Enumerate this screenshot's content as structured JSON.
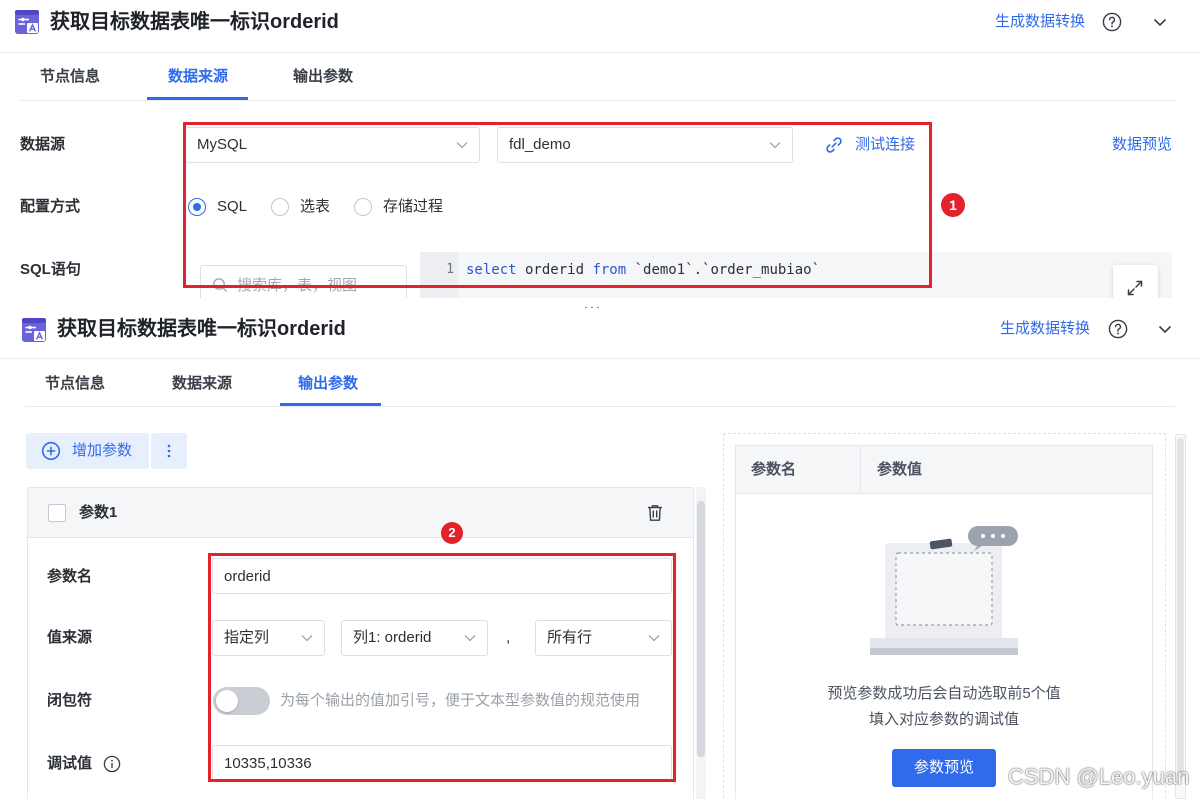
{
  "colors": {
    "accent": "#2f6bea",
    "accent_light": "#e7effd",
    "annotation_red": "#e3222c",
    "toggle_off": "#c9cdd4"
  },
  "icons": {
    "node_type": "node-type-icon",
    "help": "help-icon",
    "collapse": "chevron-down-icon",
    "select_arrow": "chevron-down-icon",
    "test_connection": "link-icon",
    "search": "search-icon",
    "expand_editor": "expand-icon",
    "resize_handle": "drag-handle-icon",
    "add_param": "add-circle-icon",
    "more": "more-vertical-icon",
    "delete": "trash-icon",
    "debug_info": "info-icon"
  },
  "top": {
    "title": "获取目标数据表唯一标识orderid",
    "generate_link": "生成数据转换",
    "tabs": [
      {
        "label": "节点信息",
        "active": false
      },
      {
        "label": "数据来源",
        "active": true
      },
      {
        "label": "输出参数",
        "active": false
      }
    ],
    "datasource": {
      "label": "数据源",
      "db_type": "MySQL",
      "db_name": "fdl_demo",
      "test_connection": "测试连接",
      "data_preview": "数据预览"
    },
    "config": {
      "label": "配置方式",
      "options": [
        {
          "label": "SQL",
          "selected": true
        },
        {
          "label": "选表",
          "selected": false
        },
        {
          "label": "存储过程",
          "selected": false
        }
      ]
    },
    "sql": {
      "label": "SQL语句",
      "search_placeholder": "搜索库，表，视图",
      "line_number": "1",
      "tokens": [
        {
          "text": "select",
          "keyword": true
        },
        {
          "text": " orderid ",
          "keyword": false
        },
        {
          "text": "from",
          "keyword": true
        },
        {
          "text": " `demo1`.`order_mubiao`",
          "keyword": false
        }
      ]
    }
  },
  "bottom": {
    "title": "获取目标数据表唯一标识orderid",
    "generate_link": "生成数据转换",
    "tabs": [
      {
        "label": "节点信息",
        "active": false
      },
      {
        "label": "数据来源",
        "active": false
      },
      {
        "label": "输出参数",
        "active": true
      }
    ],
    "add_param_button": "增加参数",
    "param_card": {
      "title": "参数1",
      "checked": false,
      "name": {
        "label": "参数名",
        "value": "orderid"
      },
      "source": {
        "label": "值来源",
        "type": "指定列",
        "column": "列1: orderid",
        "separator": ",",
        "rows": "所有行"
      },
      "wrap": {
        "label": "闭包符",
        "enabled": false,
        "hint": "为每个输出的值加引号，便于文本型参数值的规范使用"
      },
      "debug": {
        "label": "调试值",
        "value": "10335,10336"
      }
    },
    "preview": {
      "columns": [
        "参数名",
        "参数值"
      ],
      "empty_line_1": "预览参数成功后会自动选取前5个值",
      "empty_line_2": "填入对应参数的调试值",
      "button": "参数预览"
    }
  },
  "annotations": {
    "marker_1": "1",
    "marker_2": "2"
  },
  "watermark": "CSDN @Leo.yuan"
}
